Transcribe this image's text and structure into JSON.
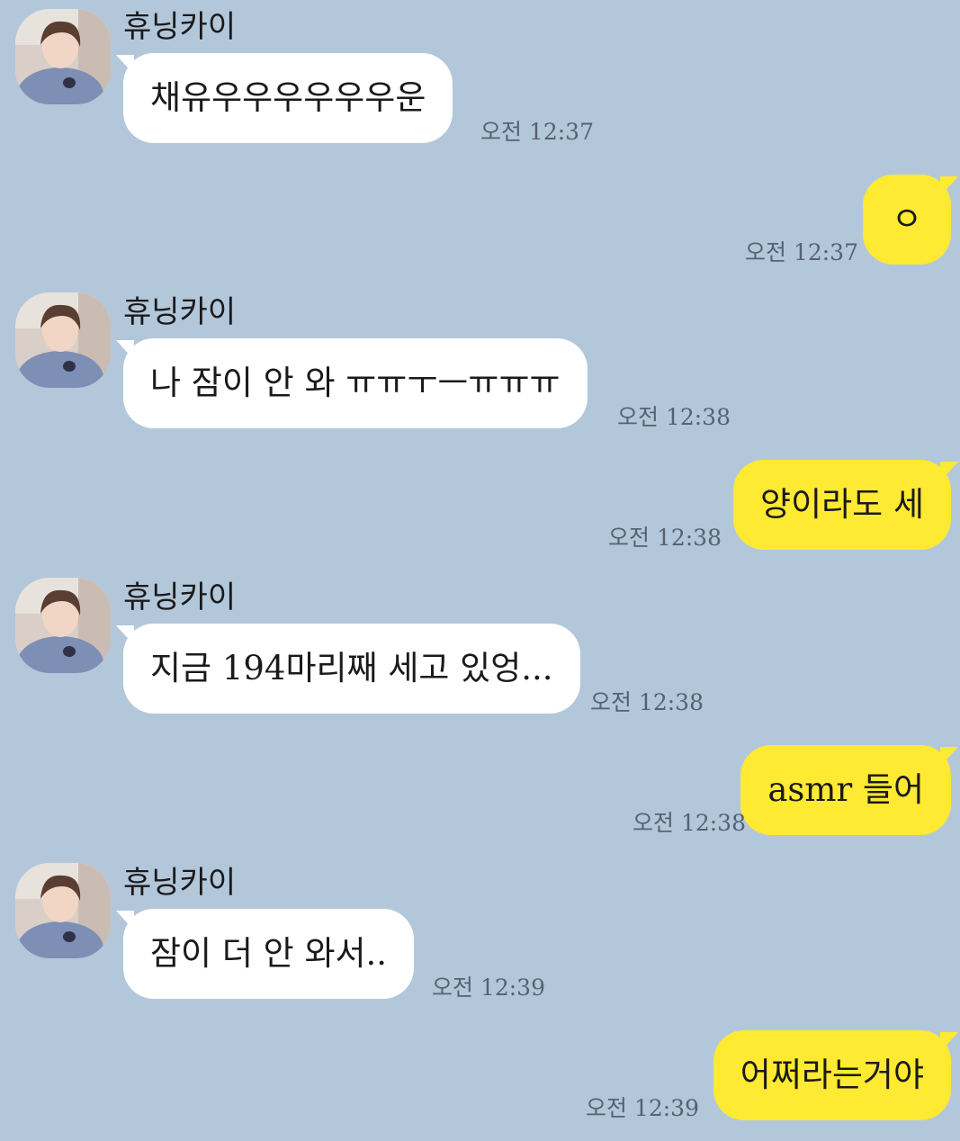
{
  "messages": [
    {
      "dir": "in",
      "sender": "휴닝카이",
      "text": "채유우우우우우우운",
      "time": "오전 12:37"
    },
    {
      "dir": "out",
      "text": "ㅇ",
      "time": "오전 12:37"
    },
    {
      "dir": "in",
      "sender": "휴닝카이",
      "text": "나 잠이 안 와 ㅠㅠㅜㅡㅠㅠㅠ",
      "time": "오전 12:38"
    },
    {
      "dir": "out",
      "text": "양이라도 세",
      "time": "오전 12:38"
    },
    {
      "dir": "in",
      "sender": "휴닝카이",
      "text": "지금 194마리째 세고 있엉...",
      "time": "오전 12:38"
    },
    {
      "dir": "out",
      "text": "asmr 들어",
      "time": "오전 12:38"
    },
    {
      "dir": "in",
      "sender": "휴닝카이",
      "text": "잠이 더 안 와서..",
      "time": "오전 12:39"
    },
    {
      "dir": "out",
      "text": "어쩌라는거야",
      "time": "오전 12:39"
    }
  ],
  "colors": {
    "background": "#b3c7db",
    "incoming_bubble": "#ffffff",
    "outgoing_bubble": "#fee933",
    "timestamp": "#556270"
  },
  "icons": {
    "avatar": "profile-photo-avatar"
  }
}
